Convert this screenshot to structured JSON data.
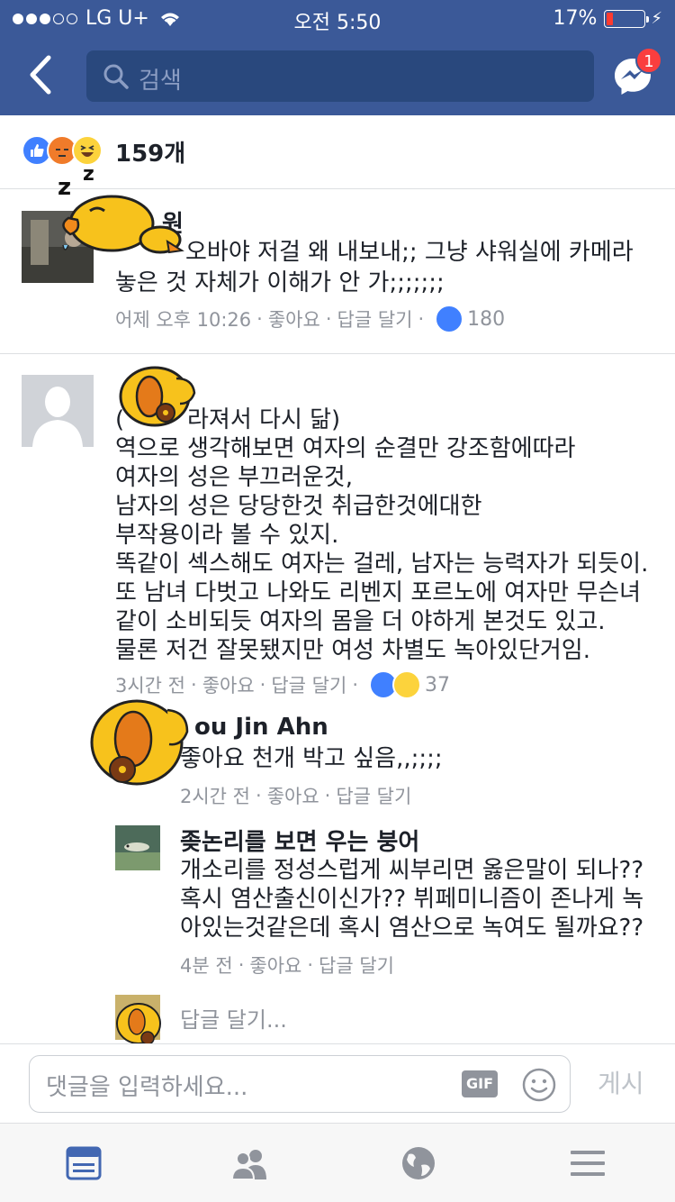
{
  "status_bar": {
    "carrier": "LG U+",
    "time": "오전 5:50",
    "battery": "17%",
    "battery_level": 0.17
  },
  "header": {
    "search_placeholder": "검색",
    "messenger_badge": "1"
  },
  "reactions_summary": {
    "count": "159개",
    "icons": [
      "like-reaction",
      "angry-reaction",
      "haha-reaction"
    ]
  },
  "comments": [
    {
      "name": "원",
      "lines": [
        "오바야 저걸 왜 내보내;; 그냥 샤워실에 카메라",
        "놓은 것 자체가 이해가 안 가;;;;;;;"
      ],
      "time": "어제 오후 10:26",
      "like": "좋아요",
      "reply": "답글 달기",
      "reaction_count": "180"
    },
    {
      "name": "",
      "lines": [
        "(",
        "라져서 다시 닮)",
        "역으로 생각해보면 여자의 순결만 강조함에따라",
        "여자의 성은 부끄러운것,",
        "남자의 성은 당당한것 취급한것에대한",
        "부작용이라 볼 수 있지.",
        "똑같이 섹스해도 여자는 걸레, 남자는 능력자가 되듯이.",
        "또 남녀 다벗고 나와도 리벤지 포르노에 여자만 무슨녀",
        "같이 소비되듯 여자의 몸을 더 야하게 본것도 있고.",
        "물론 저건 잘못됐지만 여성 차별도 녹아있단거임."
      ],
      "time": "3시간 전",
      "like": "좋아요",
      "reply": "답글 달기",
      "reaction_count": "37"
    }
  ],
  "replies": [
    {
      "name": "ou Jin Ahn",
      "lines": [
        "좋아요 천개 박고 싶음,,;;;;"
      ],
      "time": "2시간 전",
      "like": "좋아요",
      "reply": "답글 달기"
    },
    {
      "name": "좆논리를 보면 우는 붕어",
      "lines": [
        "개소리를 정성스럽게 씨부리면 옳은말이 되나??",
        "혹시 염산출신이신가?? 뷔페미니즘이 존나게 녹",
        "아있는것같은데 혹시 염산으로 녹여도 될까요??"
      ],
      "time": "4분 전",
      "like": "좋아요",
      "reply": "답글 달기"
    }
  ],
  "reply_input_placeholder": "답글 달기...",
  "composer": {
    "placeholder": "댓글을 입력하세요...",
    "gif_label": "GIF",
    "post_label": "게시"
  },
  "tabbar": [
    "news-feed-tab",
    "friends-tab",
    "globe-notifications-tab",
    "menu-tab"
  ],
  "colors": {
    "brand": "#3b5998",
    "search_bg": "#29487d",
    "like_blue": "#4080ff",
    "badge_red": "#fa3e3e",
    "meta_gray": "#90949c"
  }
}
